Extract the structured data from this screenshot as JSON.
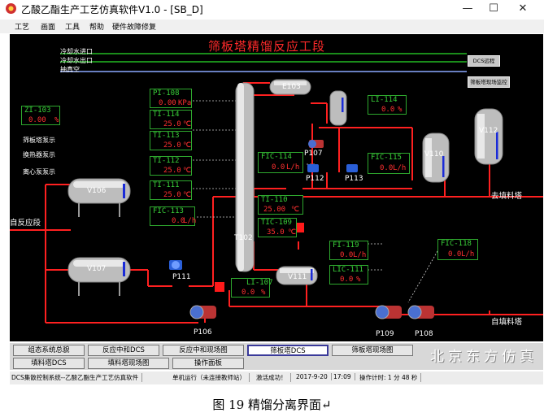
{
  "window": {
    "title": "乙酸乙酯生产工艺仿真软件V1.0 - [SB_D]",
    "minimize": "—",
    "maximize": "☐",
    "close": "✕"
  },
  "menu": [
    "工艺",
    "画面",
    "工具",
    "帮助",
    "硬件故障修复"
  ],
  "screen_title": "筛板塔精馏反应工段",
  "pipes": {
    "cooling_in": "冷却水进口",
    "cooling_out": "冷却水出口",
    "vacuum": "抽真空",
    "to_packed": "去填料塔",
    "from_reaction": "自反应段",
    "from_packed": "自填料塔"
  },
  "buttons": {
    "dcs_remote": "DCS远程",
    "field_view": "筛板塔现场监控"
  },
  "zi103": {
    "label": "ZI-103",
    "value": "0.00",
    "unit": "%"
  },
  "pumps_list": [
    "筛板塔泵示",
    "换热器泵示",
    "离心泵泵示"
  ],
  "instruments": {
    "pi108": {
      "label": "PI-108",
      "value": "0.00",
      "unit": "KPa"
    },
    "ti114": {
      "label": "TI-114",
      "value": "25.0",
      "unit": "℃"
    },
    "ti113": {
      "label": "TI-113",
      "value": "25.0",
      "unit": "℃"
    },
    "ti112": {
      "label": "TI-112",
      "value": "25.0",
      "unit": "℃"
    },
    "ti111": {
      "label": "TI-111",
      "value": "25.0",
      "unit": "℃"
    },
    "fic113": {
      "label": "FIC-113",
      "value": "0.0",
      "unit": "L/h"
    },
    "fic114": {
      "label": "FIC-114",
      "value": "0.0",
      "unit": "L/h"
    },
    "fic115": {
      "label": "FIC-115",
      "value": "0.0",
      "unit": "L/h"
    },
    "li114": {
      "label": "LI-114",
      "value": "0.0",
      "unit": "%"
    },
    "ti110": {
      "label": "TI-110",
      "value": "25.00",
      "unit": "℃"
    },
    "tic109": {
      "label": "TIC-109",
      "value": "35.0",
      "unit": "℃"
    },
    "li107": {
      "label": "LI-107",
      "value": "0.0",
      "unit": "%"
    },
    "fi119": {
      "label": "FI-119",
      "value": "0.0",
      "unit": "L/h"
    },
    "lic111": {
      "label": "LIC-111",
      "value": "0.0",
      "unit": "%"
    },
    "fic118": {
      "label": "FIC-118",
      "value": "0.0",
      "unit": "L/h"
    }
  },
  "equipment": {
    "e103": "E103",
    "v106": "V106",
    "v107": "V107",
    "v110": "V110",
    "v111": "V111",
    "v112": "V112",
    "t102": "T102",
    "p106": "P106",
    "p107": "P107",
    "p108": "P108",
    "p109": "P109",
    "p111": "P111",
    "p112": "P112",
    "p113": "P113"
  },
  "tabs_row1": [
    "组态系统总貌",
    "反应中和DCS",
    "反应中和现场图",
    "筛板塔DCS",
    "筛板塔现场图"
  ],
  "tabs_row2": [
    "填料塔DCS",
    "填料塔现场图",
    "操作面板"
  ],
  "brand": "北京东方仿真",
  "status": {
    "app": "DCS集散控制系统--乙酸乙酯生产工艺仿真软件",
    "mode": "单机运行（未连接教师站）",
    "result": "激活成功！",
    "date": "2017-9-20",
    "time": "17:09",
    "timer": "操作计时: 1 分 48 秒"
  },
  "caption": "图 19 精馏分离界面↵",
  "colors": {
    "pipe": "#ff2020",
    "cooling": "#22bb22",
    "label_green": "#39d039",
    "value_red": "#ff3030",
    "pump_blue": "#2a5fd8"
  }
}
